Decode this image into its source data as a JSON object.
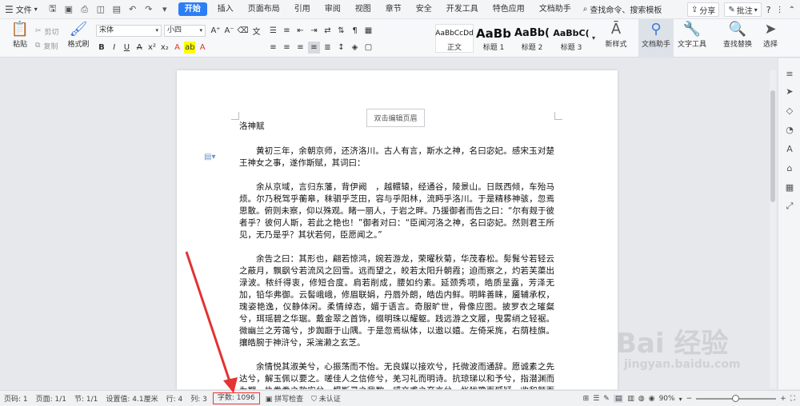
{
  "menubar": {
    "file_label": "文件",
    "tabs": [
      "开始",
      "插入",
      "页面布局",
      "引用",
      "审阅",
      "视图",
      "章节",
      "安全",
      "开发工具",
      "特色应用",
      "文档助手"
    ],
    "active_tab": "开始",
    "search_label": "查找命令、搜索模板",
    "share_label": "分享",
    "comment_label": "批注"
  },
  "ribbon": {
    "paste_label": "粘贴",
    "cut_label": "剪切",
    "copy_label": "复制",
    "format_painter_label": "格式刷",
    "font_name": "宋体",
    "font_size": "小四",
    "styles": [
      {
        "sample": "AaBbCcDd",
        "name": "正文"
      },
      {
        "sample": "AaBb",
        "name": "标题 1"
      },
      {
        "sample": "AaBb(",
        "name": "标题 2"
      },
      {
        "sample": "AaBbC(",
        "name": "标题 3"
      }
    ],
    "new_style_label": "新样式",
    "doc_helper_label": "文档助手",
    "text_tools_label": "文字工具",
    "find_replace_label": "查找替换",
    "select_label": "选择"
  },
  "document": {
    "header_placeholder": "双击编辑页眉",
    "title": "洛神赋",
    "paragraphs": [
      "黄初三年，余朝京师，还济洛川。古人有言，斯水之神，名曰宓妃。感宋玉对楚王神女之事，遂作斯赋，其词曰：",
      "余从京域，言归东藩，背伊阙　，越轘辕，经通谷，陵景山。日既西倾，车殆马烦。尔乃税驾乎蘅皋，秣驷乎芝田，容与乎阳林，流眄乎洛川。于是精移神骇，忽焉思散。俯则未察，仰以殊观。睹一丽人，于岩之畔。乃援御者而告之曰：“尔有觌于彼者乎？彼何人斯，若此之艳也！”御者对曰：“臣闻河洛之神，名曰宓妃。然则君王所见，无乃是乎？其状若何，臣愿闻之。”",
      "余告之曰：其形也，翩若惊鸿，婉若游龙，荣曜秋菊，华茂春松。髣髴兮若轻云之蔽月，飘飖兮若流风之回雪。远而望之，皎若太阳升朝霞；迫而察之，灼若芙蕖出渌波。秾纤得衷，修短合度。肩若削成，腰如约素。延颈秀项，皓质呈露，芳泽无加，铅华弗御。云髻峨峨，修眉联娟，丹唇外朗，皓齿内鲜。明眸善睐，靥辅承权，瑰姿艳逸，仪静体闲。柔情绰态，媚于语言。奇服旷世，骨像应图。披罗衣之璀粲兮，珥瑶碧之华琚。戴金翠之首饰，缀明珠以耀躯。践远游之文履，曳雾绡之轻裾。微幽兰之芳蔼兮，步踟蹰于山隅。于是忽焉纵体，以遨以嬉。左倚采旄，右荫桂旗。攘皓腕于神浒兮，采湍濑之玄芝。",
      "余情悦其淑美兮，心振荡而不怡。无良媒以接欢兮，托微波而通辞。愿诚素之先达兮，解玉佩以要之。嗟佳人之信修兮，羌习礼而明诗。抗琼珶以和予兮，指潜渊而为期。执眷眷之款实兮，惧斯灵之我欺。感交甫之弃言兮，怅犹豫而狐疑。收和颜而静志兮，申礼防以自持。"
    ]
  },
  "status": {
    "page_num": "页码: 1",
    "pages": "页面: 1/1",
    "section": "节: 1/1",
    "position": "设置值: 4.1厘米",
    "row": "行: 4",
    "col": "列: 3",
    "word_count": "字数: 1096",
    "spell_check": "拼写检查",
    "certify": "未认证",
    "zoom": "90%"
  },
  "watermark": {
    "logo_text": "Bai 经验",
    "url": "jingyan.baidu.com"
  },
  "colors": {
    "accent": "#2d7ef5",
    "highlight": "#e33333"
  }
}
